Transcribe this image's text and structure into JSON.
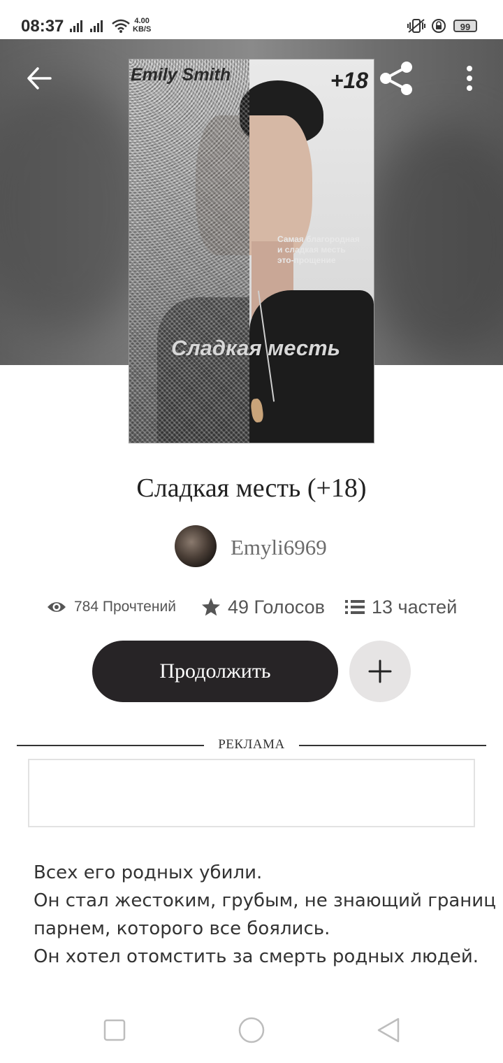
{
  "status_bar": {
    "time": "08:37",
    "net_speed_value": "4.00",
    "net_speed_unit": "KB/S",
    "battery": "99"
  },
  "cover": {
    "author": "Emily Smith",
    "age_rating": "+18",
    "quote_lines": [
      "Самая благородная",
      "и сладкая месть",
      "это-прощение"
    ],
    "title": "Сладкая месть"
  },
  "story": {
    "title": "Сладкая месть (+18)",
    "author": "Emyli6969"
  },
  "stats": {
    "reads": "784 Прочтений",
    "votes": "49 Голосов",
    "parts": "13 частей"
  },
  "actions": {
    "continue_label": "Продолжить"
  },
  "ad": {
    "label": "РЕКЛАМА"
  },
  "description": [
    "Всех его родных убили.",
    "Он стал жестоким, грубым, не знающий границ",
    "парнем, которого все боялись.",
    "Он хотел отомстить за смерть родных людей."
  ],
  "icons": {
    "back": "arrow-left-icon",
    "share": "share-icon",
    "more": "more-vertical-icon",
    "reads": "eye-icon",
    "votes": "star-icon",
    "parts": "list-icon",
    "add": "plus-icon",
    "nav_recents": "square-icon",
    "nav_home": "circle-icon",
    "nav_back": "triangle-back-icon"
  },
  "colors": {
    "primary_button": "#272426",
    "secondary_button": "#e6e4e4",
    "text": "#222222"
  }
}
